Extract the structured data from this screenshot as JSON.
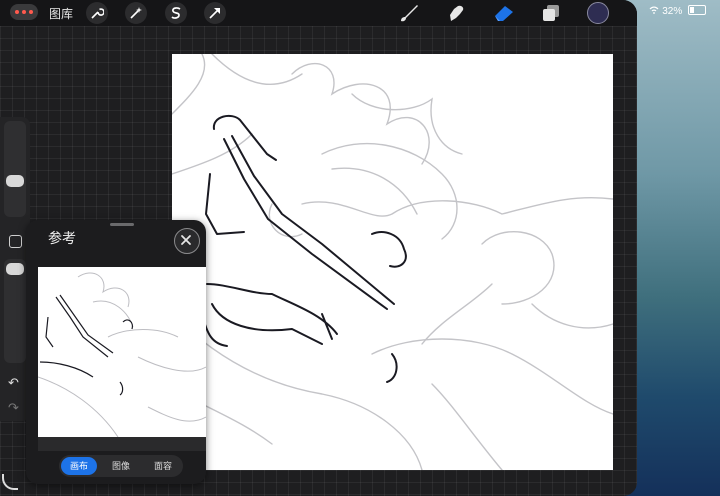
{
  "topbar": {
    "gallery_label": "图库",
    "tools": [
      "wrench-icon",
      "magic-wand-icon",
      "selection-s-icon",
      "arrow-transform-icon"
    ],
    "right_tools": [
      "brush-icon",
      "smudge-icon",
      "eraser-icon",
      "layers-icon"
    ],
    "active_tool": "eraser-icon",
    "current_color": "#2e2d52",
    "accent_color": "#1d73e8"
  },
  "status_bar": {
    "battery": "32%",
    "icons": [
      "wifi-icon",
      "battery-icon"
    ]
  },
  "reference_panel": {
    "title": "参考",
    "tabs": [
      "画布",
      "图像",
      "面容"
    ],
    "selected_tab": "画布"
  },
  "sidebar": {
    "icons": [
      "brush-size-slider",
      "modify-button",
      "opacity-slider",
      "undo-icon",
      "redo-icon"
    ]
  }
}
